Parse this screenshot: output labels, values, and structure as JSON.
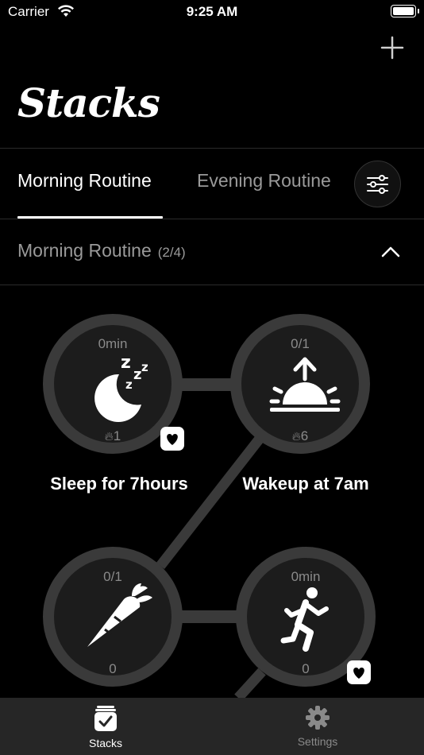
{
  "status_bar": {
    "carrier": "Carrier",
    "time": "9:25 AM"
  },
  "header": {
    "title": "Stacks",
    "add_icon": "plus-icon"
  },
  "tabs": [
    {
      "label": "Morning Routine",
      "active": true
    },
    {
      "label": "Evening Routine",
      "active": false
    }
  ],
  "filter_icon": "sliders-icon",
  "section": {
    "title": "Morning Routine",
    "count": "(2/4)",
    "collapse_icon": "chevron-up-icon"
  },
  "habits": [
    {
      "name": "Sleep for 7hours",
      "top": "0min",
      "bottom": "1",
      "icon": "moon-zzz-icon",
      "streak_icon": "flame-icon",
      "favorite": true
    },
    {
      "name": "Wakeup at 7am",
      "top": "0/1",
      "bottom": "6",
      "icon": "sunrise-icon",
      "streak_icon": "flame-icon",
      "favorite": false
    },
    {
      "name": "",
      "top": "0/1",
      "bottom": "0",
      "icon": "carrot-icon",
      "favorite": false
    },
    {
      "name": "",
      "top": "0min",
      "bottom": "0",
      "icon": "running-person-icon",
      "favorite": true
    }
  ],
  "tabbar": {
    "items": [
      {
        "label": "Stacks",
        "icon": "checklist-icon",
        "active": true
      },
      {
        "label": "Settings",
        "icon": "gear-icon",
        "active": false
      }
    ]
  },
  "colors": {
    "background": "#000000",
    "ring": "#3a3a3a",
    "ring_inner": "#1c1c1c",
    "muted_text": "#9a9a9a",
    "tabbar": "#262626"
  }
}
